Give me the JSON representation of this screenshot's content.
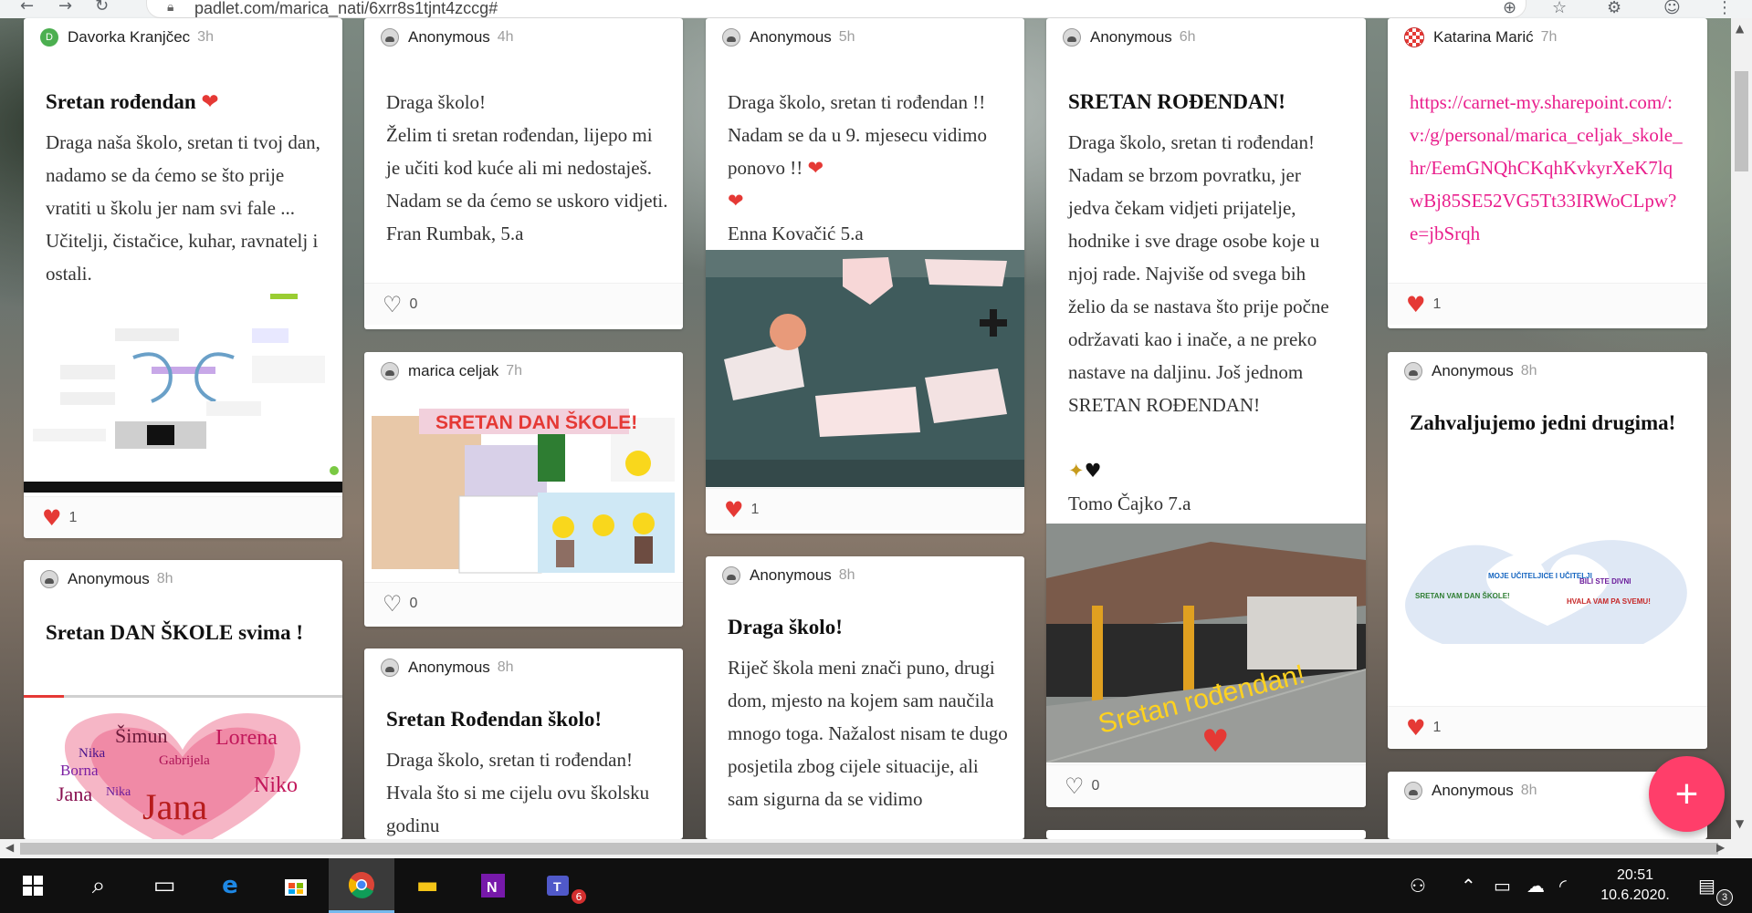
{
  "browser": {
    "url": "padlet.com/marica_nati/6xrr8s1tjnt4zccg#"
  },
  "cards": {
    "c1": {
      "author": "Davorka Kranjčec",
      "avatar_letter": "D",
      "time": "3h",
      "title": "Sretan rođendan",
      "body": "Draga naša školo, sretan ti tvoj dan, nadamo se da ćemo se što prije vratiti u školu jer nam svi fale ... Učitelji, čistačice, kuhar, ravnatelj i ostali.",
      "likes": "1"
    },
    "c2": {
      "author": "Anonymous",
      "time": "8h",
      "title": "Sretan DAN ŠKOLE svima !"
    },
    "c3": {
      "author": "Anonymous",
      "time": "4h",
      "body": "Draga školo!\nŽelim ti sretan rođendan, lijepo mi je učiti  kod kuće ali mi nedostaješ. Nadam se da ćemo se uskoro vidjeti.\n Fran Rumbak, 5.a",
      "likes": "0"
    },
    "c4": {
      "author": "marica celjak",
      "time": "7h",
      "image_caption": "SRETAN DAN ŠKOLE!",
      "likes": "0"
    },
    "c5": {
      "author": "Anonymous",
      "time": "8h",
      "title": "Sretan Rođendan školo!",
      "body": "Draga školo, sretan ti rođendan! Hvala što si me cijelu ovu školsku godinu"
    },
    "c6": {
      "author": "Anonymous",
      "time": "5h",
      "body": "Draga školo, sretan ti rođendan !! Nadam se da u 9. mjesecu vidimo ponovo !!",
      "signature": "Enna Kovačić 5.a",
      "likes": "1"
    },
    "c7": {
      "author": "Anonymous",
      "time": "8h",
      "title": "Draga školo!",
      "body": "Riječ škola meni znači puno, drugi dom, mjesto na kojem sam naučila mnogo toga. Nažalost nisam te dugo posjetila zbog cijele situacije, ali sam sigurna da se vidimo"
    },
    "c8": {
      "author": "Anonymous",
      "time": "6h",
      "title": "SRETAN ROĐENDAN!",
      "body": "Draga školo, sretan ti rođendan! Nadam se brzom povratku, jer jedva čekam vidjeti prijatelje, hodnike i sve drage osobe koje u njoj rade. Najviše od svega bih želio da se nastava što prije počne održavati kao i inače, a ne preko nastave na daljinu. Još jednom SRETAN ROĐENDAN!",
      "signature": "Tomo Čajko 7.a",
      "image_caption": "Sretan rođendan!",
      "likes": "0"
    },
    "c9": {
      "author": "Katarina Marić",
      "time": "7h",
      "link": "https://carnet-my.sharepoint.com/:v:/g/personal/marica_celjak_skole_hr/EemGNQhCKqhKvkyrXeK7lqwBj85SE52VG5Tt33IRWoCLpw?e=jbSrqh",
      "likes": "1"
    },
    "c10": {
      "author": "Anonymous",
      "time": "8h",
      "title": "Zahvaljujemo jedni drugima!",
      "likes": "1"
    },
    "c11": {
      "author": "Anonymous",
      "time": "8h"
    }
  },
  "wordcloud_heart": [
    "Šimun",
    "Lorena",
    "Borna",
    "Gabrijela",
    "Nika",
    "Jana",
    "Niko",
    "Nika"
  ],
  "wordcloud_hands": [
    "HVALA VAM PA SVEMU!",
    "MOJE UČITELJICE I UČITELJI",
    "SRETAN VAM DAN ŠKOLE!",
    "BILI STE DIVNI"
  ],
  "taskbar": {
    "time": "20:51",
    "date": "10.6.2020.",
    "teams_badge": "6",
    "notif_badge": "3"
  },
  "colors": {
    "accent": "#ff3e6a",
    "link": "#e91e8c",
    "heart": "#e53935"
  }
}
